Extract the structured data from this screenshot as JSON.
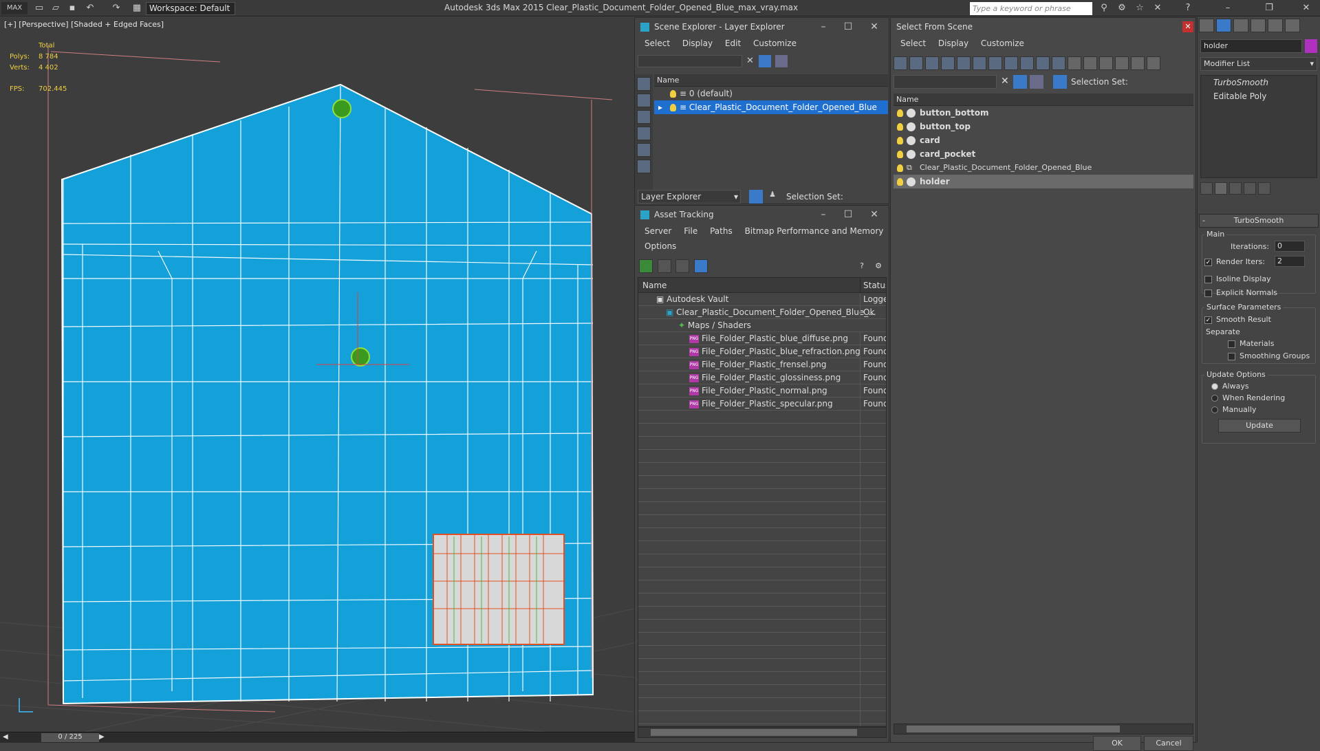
{
  "app": {
    "title": "Autodesk 3ds Max  2015     Clear_Plastic_Document_Folder_Opened_Blue_max_vray.max",
    "workspace": "Workspace: Default",
    "search_placeholder": "Type a keyword or phrase"
  },
  "viewport": {
    "label": "[+] [Perspective] [Shaded + Edged Faces]",
    "stats": {
      "total_label": "Total",
      "polys_label": "Polys:",
      "polys": "8 784",
      "verts_label": "Verts:",
      "verts": "4 402",
      "fps_label": "FPS:",
      "fps": "702.445"
    },
    "timeline": "0 / 225"
  },
  "scene_explorer": {
    "title": "Scene Explorer - Layer Explorer",
    "menu": [
      "Select",
      "Display",
      "Edit",
      "Customize"
    ],
    "column": "Name",
    "layers": [
      "0 (default)",
      "Clear_Plastic_Document_Folder_Opened_Blue"
    ],
    "footer_label": "Layer Explorer",
    "selection_set": "Selection Set:"
  },
  "asset_tracking": {
    "title": "Asset Tracking",
    "menu": [
      "Server",
      "File",
      "Paths",
      "Bitmap Performance and Memory",
      "Options"
    ],
    "columns": [
      "Name",
      "Status"
    ],
    "rows": [
      {
        "name": "Autodesk Vault",
        "status": "Logged"
      },
      {
        "name": "Clear_Plastic_Document_Folder_Opened_Blue_...",
        "status": "Ok"
      },
      {
        "name": "Maps / Shaders",
        "status": ""
      },
      {
        "name": "File_Folder_Plastic_blue_diffuse.png",
        "status": "Found"
      },
      {
        "name": "File_Folder_Plastic_blue_refraction.png",
        "status": "Found"
      },
      {
        "name": "File_Folder_Plastic_frensel.png",
        "status": "Found"
      },
      {
        "name": "File_Folder_Plastic_glossiness.png",
        "status": "Found"
      },
      {
        "name": "File_Folder_Plastic_normal.png",
        "status": "Found"
      },
      {
        "name": "File_Folder_Plastic_specular.png",
        "status": "Found"
      }
    ]
  },
  "select_from_scene": {
    "title": "Select From Scene",
    "menu": [
      "Select",
      "Display",
      "Customize"
    ],
    "selection_set": "Selection Set:",
    "column": "Name",
    "objects": [
      "button_bottom",
      "button_top",
      "card",
      "card_pocket",
      "Clear_Plastic_Document_Folder_Opened_Blue",
      "holder"
    ],
    "ok": "OK",
    "cancel": "Cancel"
  },
  "command_panel": {
    "object_name": "holder",
    "modifier_list": "Modifier List",
    "stack": [
      "TurboSmooth",
      "Editable Poly"
    ],
    "rollout": "TurboSmooth",
    "main": "Main",
    "iterations_label": "Iterations:",
    "iterations": "0",
    "render_iters_label": "Render Iters:",
    "render_iters": "2",
    "isoline": "Isoline Display",
    "explicit_normals": "Explicit Normals",
    "surface_params": "Surface Parameters",
    "smooth_result": "Smooth Result",
    "separate": "Separate",
    "materials": "Materials",
    "smoothing_groups": "Smoothing Groups",
    "update_options": "Update Options",
    "always": "Always",
    "when_rendering": "When Rendering",
    "manually": "Manually",
    "update": "Update"
  }
}
